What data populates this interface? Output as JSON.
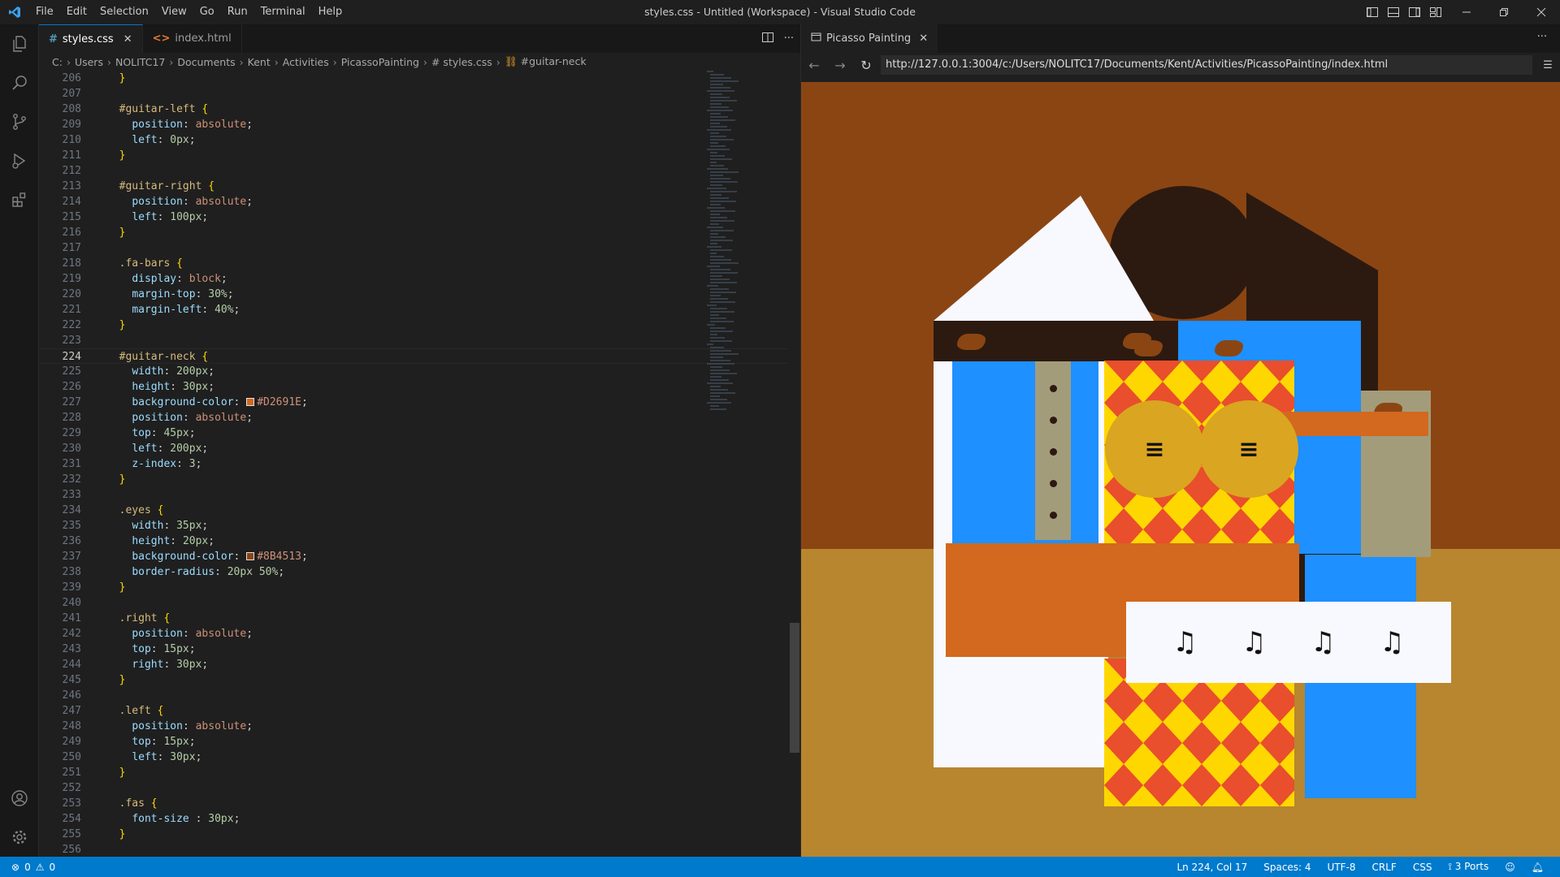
{
  "titlebar": {
    "menu": [
      "File",
      "Edit",
      "Selection",
      "View",
      "Go",
      "Run",
      "Terminal",
      "Help"
    ],
    "title": "styles.css - Untitled (Workspace) - Visual Studio Code"
  },
  "editor": {
    "tabs": [
      {
        "label": "styles.css",
        "icon": "#",
        "active": true
      },
      {
        "label": "index.html",
        "icon": "<>",
        "active": false
      }
    ],
    "breadcrumb": [
      "C:",
      "Users",
      "NOLITC17",
      "Documents",
      "Kent",
      "Activities",
      "PicassoPainting",
      "# styles.css",
      "#guitar-neck"
    ],
    "current_line": 224,
    "lines": [
      {
        "n": 206,
        "t": "  }"
      },
      {
        "n": 207,
        "t": ""
      },
      {
        "n": 208,
        "t": "  #guitar-left {"
      },
      {
        "n": 209,
        "t": "    position: absolute;"
      },
      {
        "n": 210,
        "t": "    left: 0px;"
      },
      {
        "n": 211,
        "t": "  }"
      },
      {
        "n": 212,
        "t": ""
      },
      {
        "n": 213,
        "t": "  #guitar-right {"
      },
      {
        "n": 214,
        "t": "    position: absolute;"
      },
      {
        "n": 215,
        "t": "    left: 100px;"
      },
      {
        "n": 216,
        "t": "  }"
      },
      {
        "n": 217,
        "t": ""
      },
      {
        "n": 218,
        "t": "  .fa-bars {"
      },
      {
        "n": 219,
        "t": "    display: block;"
      },
      {
        "n": 220,
        "t": "    margin-top: 30%;"
      },
      {
        "n": 221,
        "t": "    margin-left: 40%;"
      },
      {
        "n": 222,
        "t": "  }"
      },
      {
        "n": 223,
        "t": ""
      },
      {
        "n": 224,
        "t": "  #guitar-neck {"
      },
      {
        "n": 225,
        "t": "    width: 200px;"
      },
      {
        "n": 226,
        "t": "    height: 30px;"
      },
      {
        "n": 227,
        "t": "    background-color: #D2691E;"
      },
      {
        "n": 228,
        "t": "    position: absolute;"
      },
      {
        "n": 229,
        "t": "    top: 45px;"
      },
      {
        "n": 230,
        "t": "    left: 200px;"
      },
      {
        "n": 231,
        "t": "    z-index: 3;"
      },
      {
        "n": 232,
        "t": "  }"
      },
      {
        "n": 233,
        "t": ""
      },
      {
        "n": 234,
        "t": "  .eyes {"
      },
      {
        "n": 235,
        "t": "    width: 35px;"
      },
      {
        "n": 236,
        "t": "    height: 20px;"
      },
      {
        "n": 237,
        "t": "    background-color: #8B4513;"
      },
      {
        "n": 238,
        "t": "    border-radius: 20px 50%;"
      },
      {
        "n": 239,
        "t": "  }"
      },
      {
        "n": 240,
        "t": ""
      },
      {
        "n": 241,
        "t": "  .right {"
      },
      {
        "n": 242,
        "t": "    position: absolute;"
      },
      {
        "n": 243,
        "t": "    top: 15px;"
      },
      {
        "n": 244,
        "t": "    right: 30px;"
      },
      {
        "n": 245,
        "t": "  }"
      },
      {
        "n": 246,
        "t": ""
      },
      {
        "n": 247,
        "t": "  .left {"
      },
      {
        "n": 248,
        "t": "    position: absolute;"
      },
      {
        "n": 249,
        "t": "    top: 15px;"
      },
      {
        "n": 250,
        "t": "    left: 30px;"
      },
      {
        "n": 251,
        "t": "  }"
      },
      {
        "n": 252,
        "t": ""
      },
      {
        "n": 253,
        "t": "  .fas {"
      },
      {
        "n": 254,
        "t": "    font-size : 30px;"
      },
      {
        "n": 255,
        "t": "  }"
      },
      {
        "n": 256,
        "t": ""
      }
    ]
  },
  "browser": {
    "tab_label": "Picasso Painting",
    "url": "http://127.0.0.1:3004/c:/Users/NOLITC17/Documents/Kent/Activities/PicassoPainting/index.html",
    "painting": {
      "music_notes": [
        "♫",
        "♫",
        "♫",
        "♫"
      ],
      "guitar_bars": [
        "≡",
        "≡"
      ]
    }
  },
  "colors": {
    "accent": "#007acc",
    "background": "#8B4513",
    "floor": "#B8862E",
    "blue": "#1E90FF",
    "white": "#F8F8FF",
    "dark": "#2C1A10",
    "guitar": "#DAA520",
    "neck": "#D2691E",
    "red": "#E94E2D",
    "yellow": "#FFD700",
    "khaki": "#A39C7A"
  },
  "statusbar": {
    "errors": "0",
    "warnings": "0",
    "position": "Ln 224, Col 17",
    "spaces": "Spaces: 4",
    "encoding": "UTF-8",
    "eol": "CRLF",
    "language": "CSS",
    "ports": "3 Ports"
  }
}
